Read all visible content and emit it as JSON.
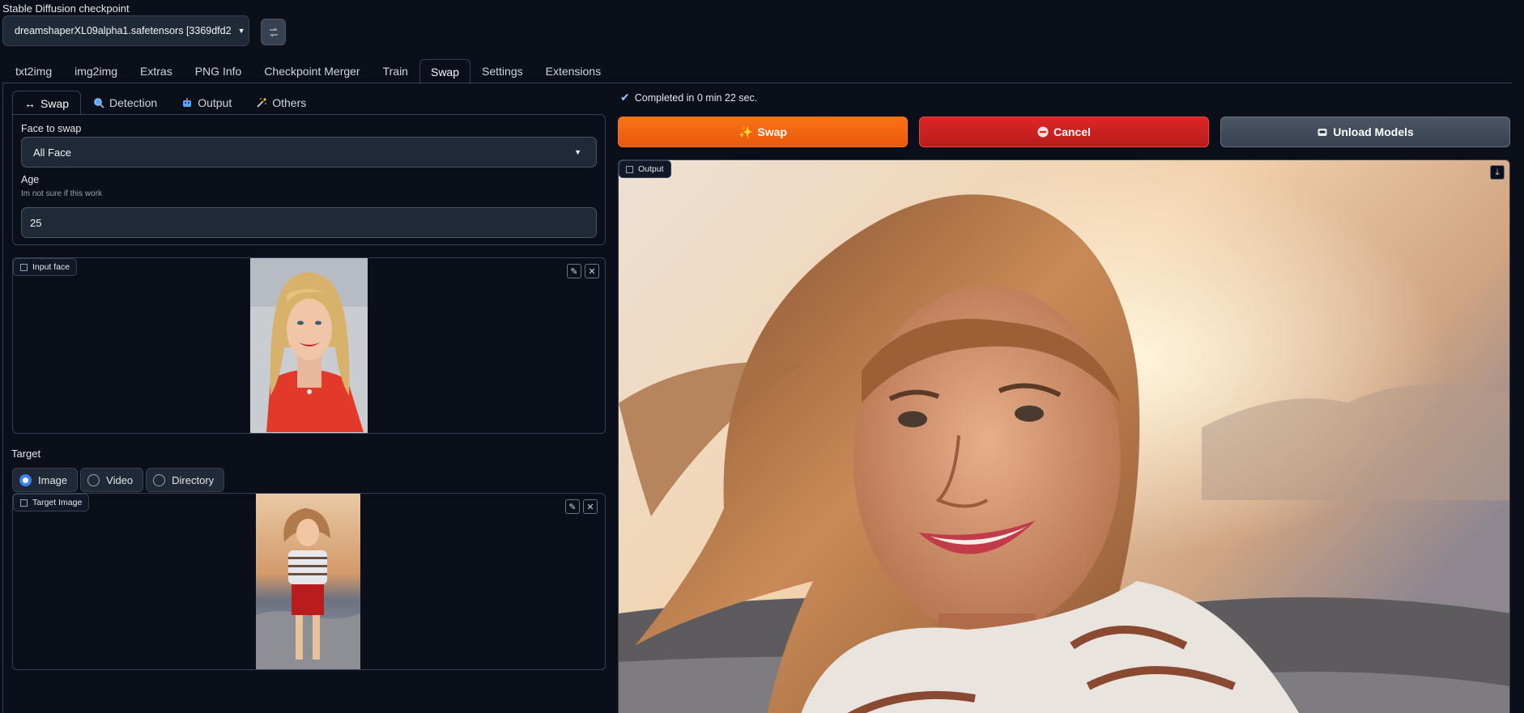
{
  "checkpoint": {
    "label": "Stable Diffusion checkpoint",
    "value": "dreamshaperXL09alpha1.safetensors [3369dfd2"
  },
  "main_tabs": [
    {
      "label": "txt2img"
    },
    {
      "label": "img2img"
    },
    {
      "label": "Extras"
    },
    {
      "label": "PNG Info"
    },
    {
      "label": "Checkpoint Merger"
    },
    {
      "label": "Train"
    },
    {
      "label": "Swap",
      "active": true
    },
    {
      "label": "Settings"
    },
    {
      "label": "Extensions"
    }
  ],
  "sub_tabs": [
    {
      "icon": "arrows-icon",
      "label": "Swap",
      "active": true
    },
    {
      "icon": "magnifier-icon",
      "label": "Detection"
    },
    {
      "icon": "robot-icon",
      "label": "Output"
    },
    {
      "icon": "magic-wand-icon",
      "label": "Others"
    }
  ],
  "swap_settings": {
    "face_label": "Face to swap",
    "face_value": "All Face",
    "age_label": "Age",
    "age_info": "Im not sure if this work",
    "age_value": "25"
  },
  "input_face": {
    "label": "Input face"
  },
  "target": {
    "label": "Target",
    "options": [
      {
        "label": "Image",
        "selected": true
      },
      {
        "label": "Video",
        "selected": false
      },
      {
        "label": "Directory",
        "selected": false
      }
    ],
    "image_label": "Target Image"
  },
  "status": {
    "text": "Completed in 0 min 22 sec."
  },
  "actions": {
    "swap_label": "Swap",
    "cancel_label": "Cancel",
    "unload_label": "Unload Models"
  },
  "output": {
    "label": "Output"
  },
  "colors": {
    "background": "#0b0f19",
    "swap_button": "#f97316",
    "cancel_button": "#dc2626",
    "unload_button": "#4b5563",
    "radio_selected": "#3b82f6"
  }
}
